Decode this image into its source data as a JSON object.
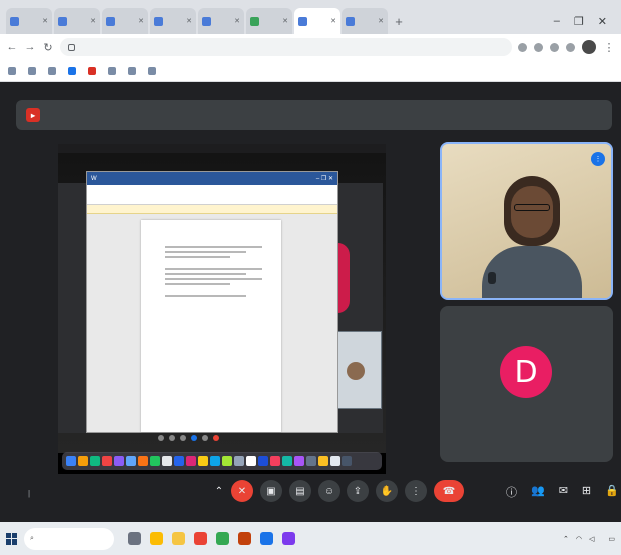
{
  "browser": {
    "tabs": [
      {
        "title": "",
        "active": false,
        "icon": "blue"
      },
      {
        "title": "",
        "active": false,
        "icon": "blue"
      },
      {
        "title": "",
        "active": false,
        "icon": "blue"
      },
      {
        "title": "",
        "active": false,
        "icon": "blue"
      },
      {
        "title": "",
        "active": false,
        "icon": "blue"
      },
      {
        "title": "",
        "active": false,
        "icon": "green"
      },
      {
        "title": "",
        "active": true,
        "icon": "blue"
      },
      {
        "title": "",
        "active": false,
        "icon": "blue"
      }
    ],
    "url": "",
    "bookmarks": [
      "",
      "",
      "",
      "",
      "",
      "",
      "",
      ""
    ]
  },
  "meet": {
    "banner_text": "",
    "participants": [
      {
        "name": "",
        "type": "camera"
      },
      {
        "name": "",
        "initial": "D",
        "type": "avatar"
      }
    ],
    "time": "",
    "meeting_code": "",
    "avatar_color": "#e91e63"
  },
  "document": {
    "sections": [
      "",
      "",
      ""
    ]
  },
  "taskbar": {
    "search_placeholder": "",
    "weather": "",
    "time": "",
    "date": ""
  },
  "colors": {
    "end_call": "#ea4335",
    "accent": "#1a73e8",
    "recording": "#d93025"
  }
}
